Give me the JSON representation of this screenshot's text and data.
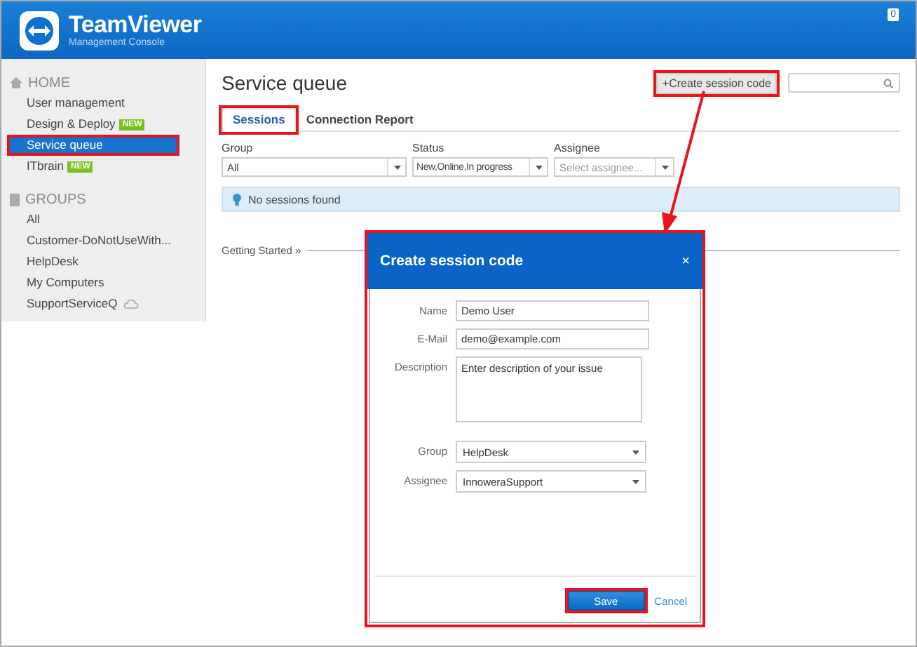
{
  "header": {
    "brand": "TeamViewer",
    "subtitle": "Management Console",
    "notifications": "0"
  },
  "sidebar": {
    "sections": [
      {
        "kind": "home",
        "title": "HOME",
        "items": [
          {
            "label": "User management",
            "selected": false,
            "annotated": false
          },
          {
            "label": "Design & Deploy",
            "badge": "NEW",
            "selected": false,
            "annotated": false
          },
          {
            "label": "Service queue",
            "selected": true,
            "annotated": true
          },
          {
            "label": "ITbrain",
            "badge": "NEW",
            "selected": false,
            "annotated": false
          }
        ]
      },
      {
        "kind": "groups",
        "title": "GROUPS",
        "items": [
          {
            "label": "All",
            "selected": false,
            "annotated": false
          },
          {
            "label": "Customer-DoNotUseWith...",
            "selected": false,
            "annotated": false
          },
          {
            "label": "HelpDesk",
            "selected": false,
            "annotated": false
          },
          {
            "label": "My Computers",
            "selected": false,
            "annotated": false
          },
          {
            "label": "SupportServiceQ",
            "cloud": true,
            "selected": false,
            "annotated": false
          }
        ]
      }
    ]
  },
  "main": {
    "title": "Service queue",
    "create_button": {
      "label": "+Create session code",
      "annotated": true
    },
    "tabs": [
      {
        "label": "Sessions",
        "selected": true,
        "annotated": true
      },
      {
        "label": "Connection Report",
        "selected": false,
        "annotated": false
      }
    ],
    "filters": [
      {
        "label": "Group",
        "value": "All"
      },
      {
        "label": "Status",
        "value": "New,Online,In progress"
      },
      {
        "label": "Assignee",
        "placeholder": "Select assignee..."
      }
    ],
    "alert": "No sessions found",
    "getting_started": "Getting Started »"
  },
  "dialog": {
    "title": "Create session code",
    "close": "×",
    "annotated": true,
    "fields": [
      {
        "kind": "input",
        "label": "Name",
        "value": "Demo User"
      },
      {
        "kind": "input",
        "label": "E-Mail",
        "value": "demo@example.com"
      },
      {
        "kind": "textarea",
        "label": "Description",
        "placeholder": "Enter description of your issue"
      },
      {
        "kind": "select",
        "label": "Group",
        "value": "HelpDesk"
      },
      {
        "kind": "select",
        "label": "Assignee",
        "value": "InnoweraSupport"
      }
    ],
    "save": {
      "label": "Save",
      "annotated": true
    },
    "cancel": "Cancel"
  }
}
